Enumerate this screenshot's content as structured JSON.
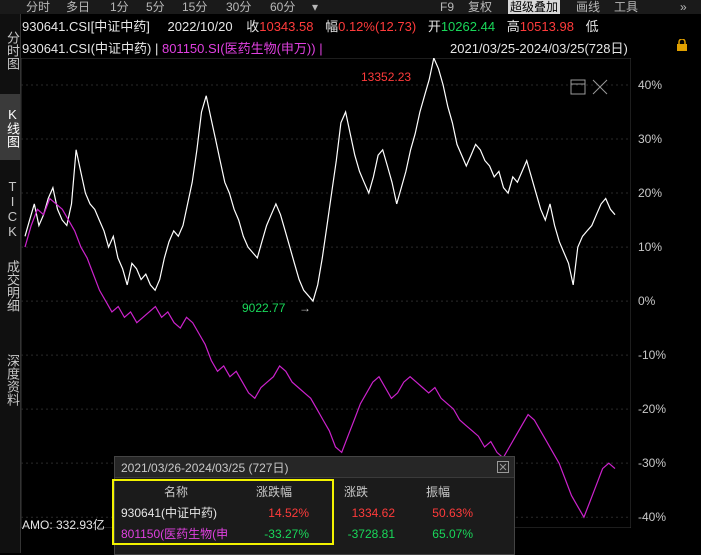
{
  "toolbar": {
    "items": [
      "分时",
      "多日",
      "1分",
      "5分",
      "15分",
      "30分",
      "60分",
      "▾",
      "F9",
      "复权",
      "超级叠加",
      "画线",
      "工具",
      "»"
    ]
  },
  "sidebar": {
    "tabs": [
      "分时图",
      "K线图",
      "TICK",
      "成交明细",
      "深度资料"
    ]
  },
  "info1": {
    "code": "930641.CSI[中证中药]",
    "date": "2022/10/20",
    "close_label": "收",
    "close": "10343.58",
    "change_label": "幅",
    "change_pct": "0.12%",
    "change_val": "(12.73)",
    "open_label": "开",
    "open": "10262.44",
    "high_label": "高",
    "high": "10513.98",
    "low_label": "低"
  },
  "info2": {
    "main": "930641.CSI(中证中药)",
    "sep1": "|",
    "overlay": "801150.SI(医药生物(申万))",
    "sep2": "|",
    "range": "2021/03/25-2024/03/25(728日)"
  },
  "annotations": {
    "high_value": "13352.23",
    "low_value": "9022.77",
    "low_arrow": "→"
  },
  "chart_data": {
    "type": "line",
    "y_unit": "%",
    "y_ticks": [
      "40%",
      "30%",
      "20%",
      "10%",
      "0%",
      "-10%",
      "-20%",
      "-30%",
      "-40%"
    ],
    "ylim": [
      -42,
      45
    ],
    "series": [
      {
        "name": "930641(中证中药)",
        "color": "#ffffff",
        "values": [
          12,
          15,
          18,
          14,
          16,
          19,
          21,
          17,
          15,
          14,
          18,
          28,
          24,
          20,
          18,
          17,
          15,
          13,
          10,
          12,
          8,
          6,
          3,
          7,
          6,
          4,
          5,
          3,
          2,
          4,
          8,
          11,
          13,
          12,
          14,
          18,
          22,
          28,
          35,
          38,
          34,
          30,
          26,
          22,
          20,
          17,
          15,
          12,
          10,
          9,
          8,
          11,
          14,
          16,
          18,
          16,
          13,
          10,
          7,
          4,
          2,
          1,
          0,
          3,
          8,
          14,
          20,
          26,
          33,
          35,
          31,
          27,
          24,
          22,
          20,
          23,
          27,
          28,
          25,
          22,
          18,
          21,
          24,
          28,
          31,
          35,
          38,
          41,
          45,
          43,
          40,
          36,
          33,
          29,
          27,
          25,
          27,
          29,
          28,
          26,
          25,
          23,
          24,
          21,
          20,
          23,
          22,
          24,
          26,
          23,
          20,
          17,
          15,
          18,
          14,
          11,
          9,
          7,
          3,
          10,
          12,
          13,
          14,
          16,
          18,
          19,
          17,
          16
        ]
      },
      {
        "name": "801150(医药生物(申万))",
        "color": "#cc22cc",
        "values": [
          10,
          14,
          17,
          16,
          19,
          18,
          17,
          15,
          13,
          10,
          8,
          5,
          2,
          0,
          -2,
          -1,
          -3,
          -2,
          -4,
          -3,
          -2,
          -1,
          -3,
          -2,
          -4,
          -5,
          -3,
          -4,
          -6,
          -8,
          -11,
          -13,
          -12,
          -14,
          -13,
          -15,
          -17,
          -18,
          -16,
          -15,
          -14,
          -12,
          -13,
          -15,
          -16,
          -17,
          -18,
          -20,
          -22,
          -24,
          -27,
          -28,
          -25,
          -22,
          -19,
          -17,
          -15,
          -14,
          -16,
          -18,
          -17,
          -15,
          -14,
          -15,
          -16,
          -17,
          -16,
          -18,
          -19,
          -20,
          -22,
          -23,
          -24,
          -25,
          -27,
          -26,
          -28,
          -29,
          -27,
          -25,
          -23,
          -21,
          -22,
          -24,
          -26,
          -28,
          -30,
          -33,
          -36,
          -38,
          -40,
          -37,
          -34,
          -31,
          -30,
          -31
        ]
      }
    ]
  },
  "popup": {
    "title": "2021/03/26-2024/03/25 (727日)",
    "headers": [
      "名称",
      "涨跌幅",
      "涨跌",
      "振幅"
    ],
    "rows": [
      {
        "name": "930641(中证中药)",
        "pct": "14.52%",
        "chg": "1334.62",
        "amp": "50.63%"
      },
      {
        "name": "801150(医药生物(申",
        "pct": "-33.27%",
        "chg": "-3728.81",
        "amp": "65.07%"
      }
    ]
  },
  "amo": "AMO: 332.93亿"
}
